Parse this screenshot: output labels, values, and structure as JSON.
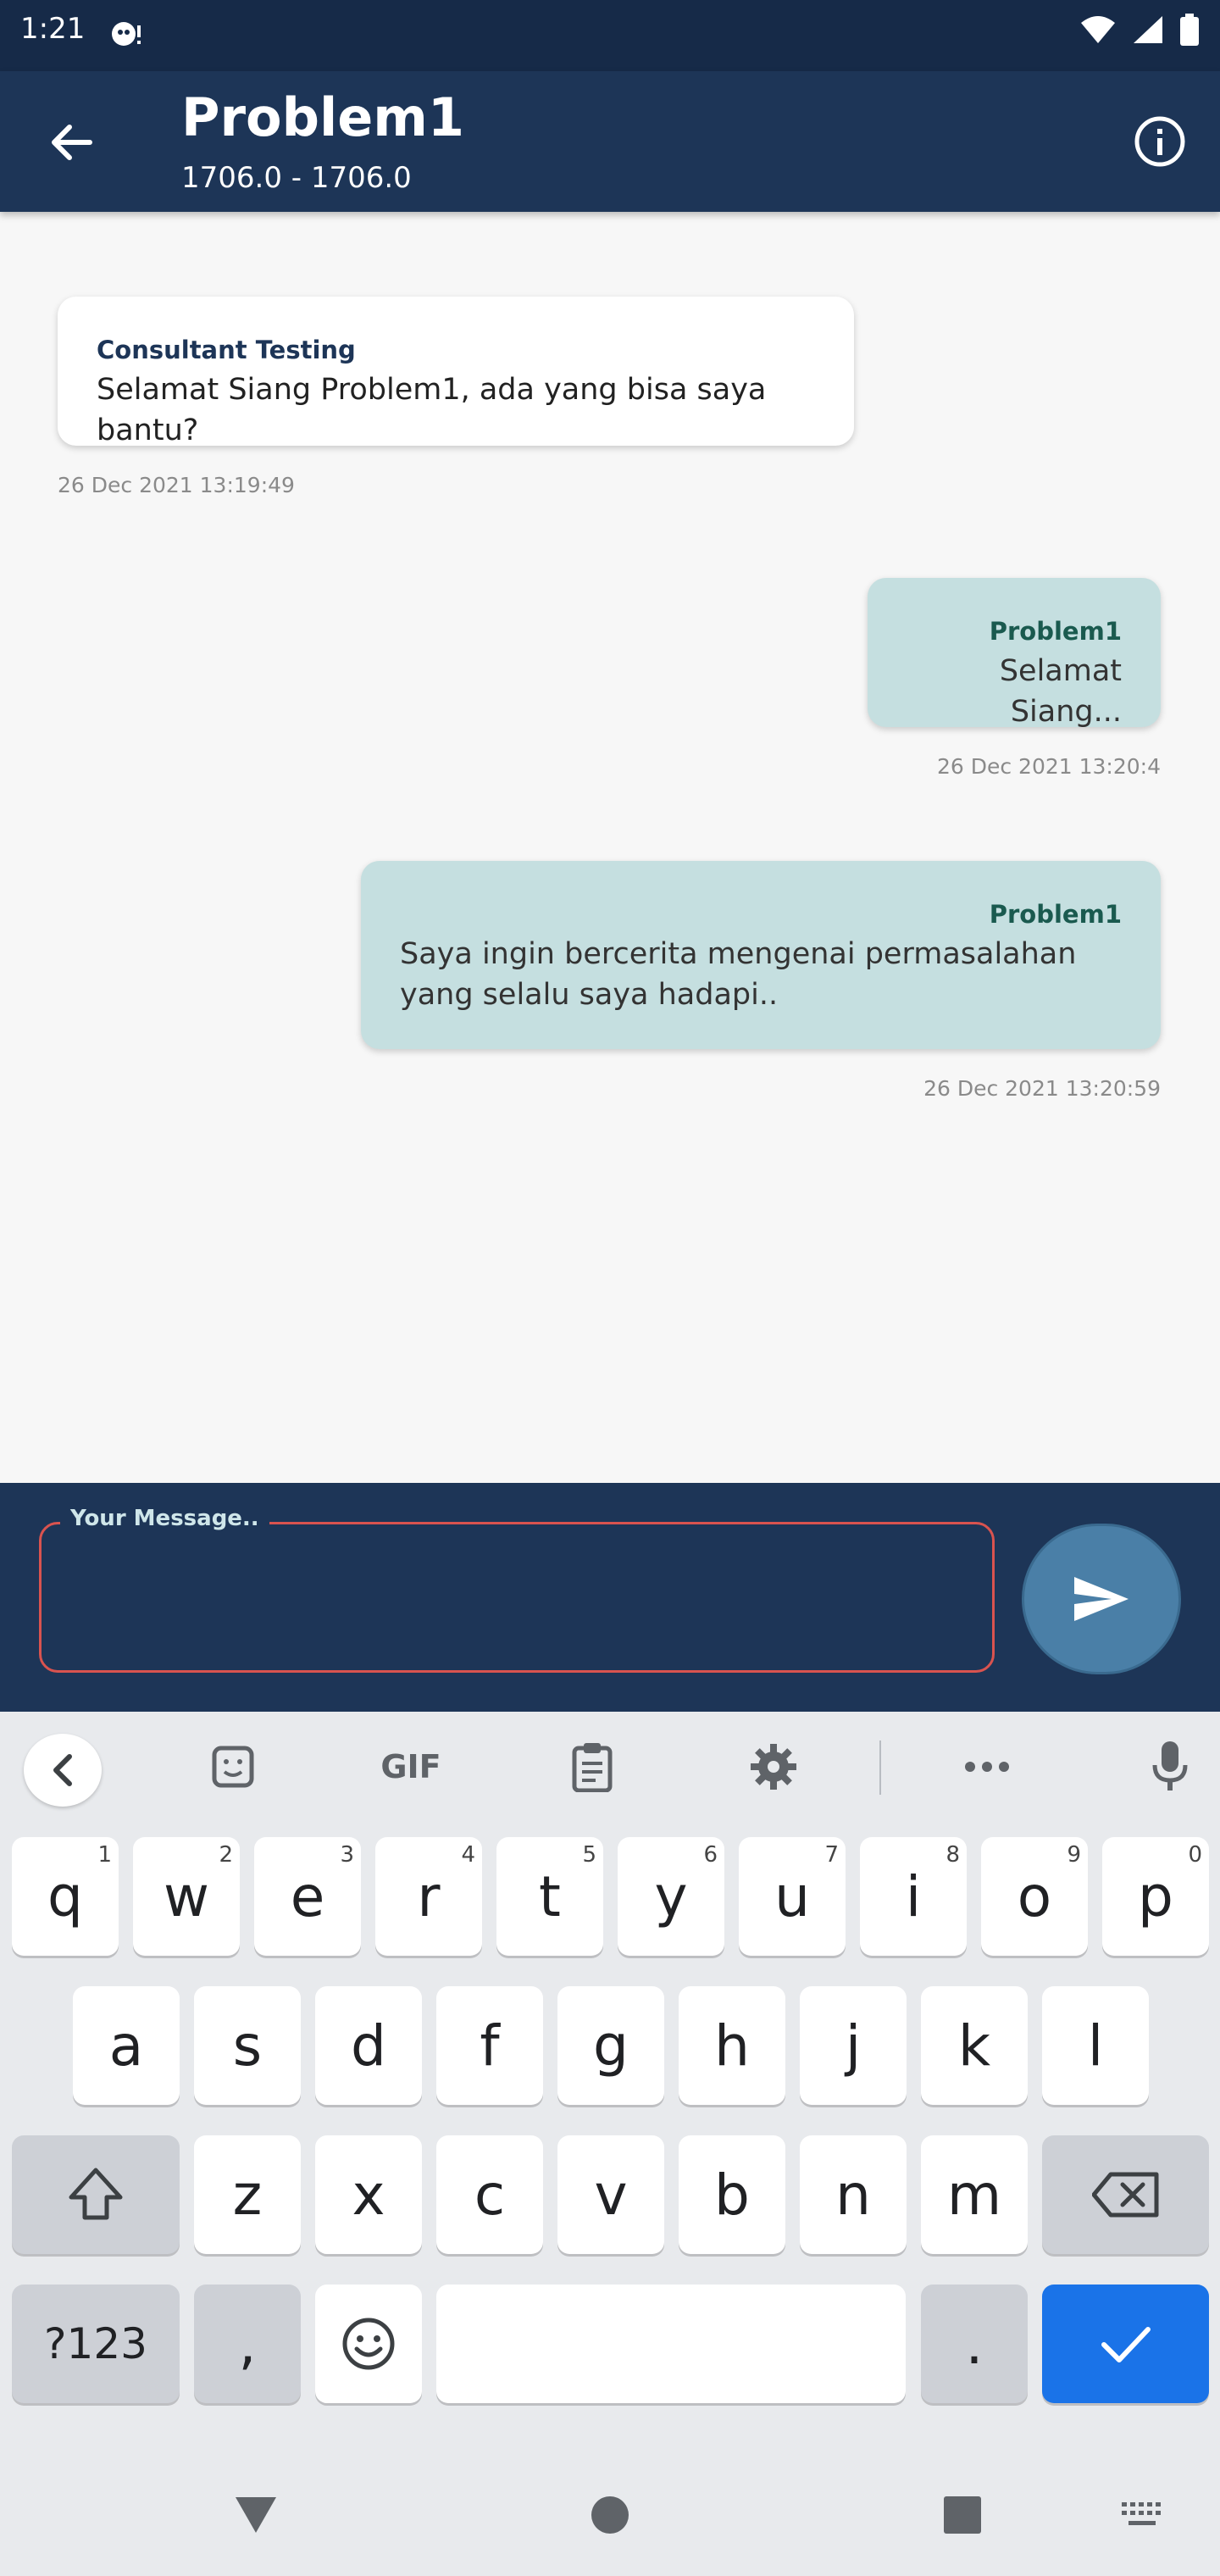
{
  "status_bar": {
    "time": "1:21"
  },
  "app_bar": {
    "title": "Problem1",
    "subtitle": "1706.0 - 1706.0"
  },
  "messages": [
    {
      "direction": "in",
      "sender": "Consultant Testing",
      "text": "Selamat Siang Problem1, ada yang bisa saya bantu?",
      "timestamp": "26 Dec 2021 13:19:49"
    },
    {
      "direction": "out",
      "sender": "Problem1",
      "text": "Selamat Siang...",
      "timestamp": "26 Dec 2021 13:20:4"
    },
    {
      "direction": "out",
      "sender": "Problem1",
      "text": "Saya ingin bercerita mengenai permasalahan yang selalu saya hadapi..",
      "timestamp": "26 Dec 2021 13:20:59"
    }
  ],
  "input": {
    "label": "Your Message..",
    "value": ""
  },
  "keyboard": {
    "toolbar": {
      "gif_label": "GIF"
    },
    "row1": [
      {
        "key": "q",
        "hint": "1"
      },
      {
        "key": "w",
        "hint": "2"
      },
      {
        "key": "e",
        "hint": "3"
      },
      {
        "key": "r",
        "hint": "4"
      },
      {
        "key": "t",
        "hint": "5"
      },
      {
        "key": "y",
        "hint": "6"
      },
      {
        "key": "u",
        "hint": "7"
      },
      {
        "key": "i",
        "hint": "8"
      },
      {
        "key": "o",
        "hint": "9"
      },
      {
        "key": "p",
        "hint": "0"
      }
    ],
    "row2": [
      "a",
      "s",
      "d",
      "f",
      "g",
      "h",
      "j",
      "k",
      "l"
    ],
    "row3": [
      "z",
      "x",
      "c",
      "v",
      "b",
      "n",
      "m"
    ],
    "row4": {
      "symbols": "?123",
      "comma": ",",
      "period": "."
    }
  },
  "colors": {
    "app_bar": "#1d3557",
    "status_bar": "#162a48",
    "outgoing_bubble": "#c5dfe0",
    "send_button": "#4a7fa7",
    "enter_key": "#1a73e8",
    "field_border": "#d9534f"
  }
}
